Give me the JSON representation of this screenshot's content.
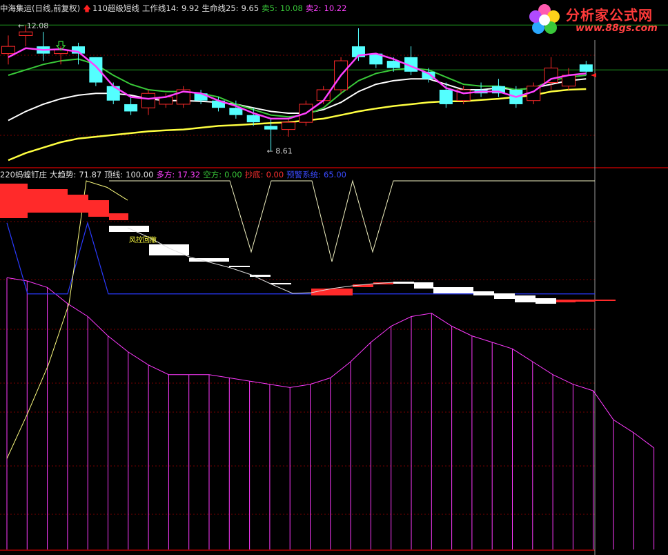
{
  "header_top": {
    "stock": "中海集运(日线,前复权)",
    "indicator": "110超级短线",
    "work_line_label": "工作线14:",
    "work_line_value": "9.92",
    "life_line_label": "生命线25:",
    "life_line_value": "9.65",
    "sell5_label": "卖5:",
    "sell5_value": "10.08",
    "sell2_label": "卖2:",
    "sell2_value": "10.22"
  },
  "header_bottom": {
    "indicator": "220蚂蝗钉庄",
    "trend_label": "大趋势:",
    "trend_value": "71.87",
    "top_label": "顶线:",
    "top_value": "100.00",
    "long_label": "多方:",
    "long_value": "17.32",
    "short_label": "空方:",
    "short_value": "0.00",
    "bottom_label": "抄底:",
    "bottom_value": "0.00",
    "alert_label": "预警系统:",
    "alert_value": "65.00"
  },
  "logo": {
    "title": "分析家公式网",
    "url": "www.88gs.com"
  },
  "annotations": {
    "high_label": "12.08",
    "low_label": "8.61",
    "stage_label": "风控回撤"
  },
  "colors": {
    "up": "#ff2a2a",
    "down": "#54ffff",
    "work_line": "#ff40ff",
    "life_line": "#39c939",
    "white_line": "#ffffff",
    "yellow_line": "#ffff40",
    "trend_line": "#ffff80",
    "alert_line": "#2a3aff",
    "long_bars": "#ff3aff",
    "grid": "#7a0000",
    "separator": "#b30000",
    "ref_line": "#20a020",
    "arrow": "#ff2020"
  },
  "chart_data": [
    {
      "type": "candlestick",
      "title": "中海集运(日线,前复权)",
      "annotations": {
        "high": 12.08,
        "low": 8.61
      },
      "ylim": [
        8.2,
        12.4
      ],
      "candles": [
        {
          "o": 11.3,
          "h": 11.8,
          "l": 11.0,
          "c": 11.5
        },
        {
          "o": 11.8,
          "h": 12.08,
          "l": 11.5,
          "c": 11.9
        },
        {
          "o": 11.5,
          "h": 11.9,
          "l": 11.1,
          "c": 11.3
        },
        {
          "o": 11.3,
          "h": 11.5,
          "l": 11.0,
          "c": 11.4
        },
        {
          "o": 11.5,
          "h": 11.6,
          "l": 11.0,
          "c": 11.3
        },
        {
          "o": 11.2,
          "h": 11.2,
          "l": 10.4,
          "c": 10.5
        },
        {
          "o": 10.4,
          "h": 10.5,
          "l": 9.9,
          "c": 10.0
        },
        {
          "o": 9.9,
          "h": 10.1,
          "l": 9.6,
          "c": 9.7
        },
        {
          "o": 9.8,
          "h": 10.3,
          "l": 9.6,
          "c": 10.2
        },
        {
          "o": 9.9,
          "h": 10.2,
          "l": 9.8,
          "c": 10.1
        },
        {
          "o": 9.9,
          "h": 10.4,
          "l": 9.8,
          "c": 10.3
        },
        {
          "o": 10.2,
          "h": 10.3,
          "l": 9.9,
          "c": 10.0
        },
        {
          "o": 10.0,
          "h": 10.1,
          "l": 9.7,
          "c": 9.8
        },
        {
          "o": 9.8,
          "h": 10.0,
          "l": 9.5,
          "c": 9.6
        },
        {
          "o": 9.6,
          "h": 9.8,
          "l": 9.3,
          "c": 9.4
        },
        {
          "o": 9.3,
          "h": 9.5,
          "l": 8.61,
          "c": 9.2
        },
        {
          "o": 9.2,
          "h": 9.5,
          "l": 9.0,
          "c": 9.4
        },
        {
          "o": 9.4,
          "h": 10.0,
          "l": 9.3,
          "c": 9.9
        },
        {
          "o": 10.0,
          "h": 10.4,
          "l": 9.9,
          "c": 10.3
        },
        {
          "o": 10.3,
          "h": 11.2,
          "l": 10.2,
          "c": 11.1
        },
        {
          "o": 11.5,
          "h": 12.0,
          "l": 11.1,
          "c": 11.2
        },
        {
          "o": 11.3,
          "h": 11.3,
          "l": 10.9,
          "c": 11.0
        },
        {
          "o": 11.1,
          "h": 11.2,
          "l": 10.8,
          "c": 10.9
        },
        {
          "o": 11.2,
          "h": 11.5,
          "l": 10.7,
          "c": 10.8
        },
        {
          "o": 10.8,
          "h": 10.9,
          "l": 10.5,
          "c": 10.6
        },
        {
          "o": 10.3,
          "h": 10.5,
          "l": 9.8,
          "c": 9.9
        },
        {
          "o": 10.0,
          "h": 10.4,
          "l": 9.9,
          "c": 10.3
        },
        {
          "o": 10.3,
          "h": 10.5,
          "l": 10.1,
          "c": 10.2
        },
        {
          "o": 10.4,
          "h": 10.6,
          "l": 10.1,
          "c": 10.2
        },
        {
          "o": 10.3,
          "h": 10.4,
          "l": 9.8,
          "c": 9.9
        },
        {
          "o": 10.0,
          "h": 10.5,
          "l": 9.9,
          "c": 10.4
        },
        {
          "o": 10.5,
          "h": 11.2,
          "l": 10.3,
          "c": 10.9
        },
        {
          "o": 10.4,
          "h": 10.9,
          "l": 10.3,
          "c": 10.7
        },
        {
          "o": 11.0,
          "h": 11.1,
          "l": 10.7,
          "c": 10.8
        }
      ],
      "series": [
        {
          "name": "工作线14",
          "values": [
            11.2,
            11.45,
            11.4,
            11.42,
            11.35,
            10.95,
            10.4,
            10.1,
            10.05,
            10.1,
            10.25,
            10.2,
            10.0,
            9.85,
            9.65,
            9.5,
            9.5,
            9.65,
            10.0,
            10.7,
            11.25,
            11.3,
            11.15,
            10.95,
            10.75,
            10.35,
            10.2,
            10.25,
            10.25,
            10.1,
            10.25,
            10.6,
            10.7,
            10.75
          ]
        },
        {
          "name": "生命线25",
          "values": [
            10.7,
            10.85,
            11.0,
            11.1,
            11.15,
            11.0,
            10.7,
            10.45,
            10.3,
            10.25,
            10.25,
            10.2,
            10.1,
            9.9,
            9.75,
            9.6,
            9.55,
            9.6,
            9.8,
            10.2,
            10.55,
            10.75,
            10.85,
            10.9,
            10.85,
            10.65,
            10.45,
            10.4,
            10.4,
            10.3,
            10.35,
            10.55,
            10.65,
            10.7
          ]
        },
        {
          "values": [
            9.45,
            9.7,
            9.9,
            10.05,
            10.15,
            10.2,
            10.2,
            10.15,
            10.05,
            10.0,
            10.0,
            9.98,
            9.95,
            9.9,
            9.8,
            9.7,
            9.65,
            9.65,
            9.75,
            9.95,
            10.25,
            10.45,
            10.55,
            10.6,
            10.6,
            10.45,
            10.3,
            10.3,
            10.35,
            10.3,
            10.35,
            10.45,
            10.55,
            10.6
          ]
        },
        {
          "values": [
            8.35,
            8.55,
            8.7,
            8.85,
            8.95,
            9.0,
            9.05,
            9.1,
            9.15,
            9.18,
            9.2,
            9.25,
            9.3,
            9.32,
            9.35,
            9.38,
            9.4,
            9.45,
            9.5,
            9.6,
            9.7,
            9.78,
            9.85,
            9.9,
            9.95,
            9.98,
            9.98,
            10.02,
            10.05,
            10.1,
            10.15,
            10.25,
            10.3,
            10.32
          ]
        }
      ]
    },
    {
      "type": "indicator",
      "title": "220蚂蝗钉庄",
      "ylim": [
        -15,
        100
      ],
      "reference_line": 100,
      "series": [
        {
          "name": "顶线",
          "values": [
            100,
            100,
            100,
            100,
            100,
            100,
            100,
            100,
            100,
            100,
            100,
            100,
            100,
            100,
            100,
            100,
            100,
            100,
            100,
            100,
            100,
            100,
            100,
            100,
            100,
            100,
            100,
            100,
            100,
            100,
            100,
            100,
            100,
            100,
            100,
            100,
            100,
            100,
            100,
            100,
            100,
            100,
            100,
            100,
            100,
            100,
            100,
            100,
            100,
            100,
            100,
            100,
            100,
            100,
            100,
            100,
            100,
            100,
            100,
            100,
            100,
            100,
            100,
            100,
            100,
            100,
            100,
            100,
            100,
            100,
            100,
            100,
            100,
            100,
            100,
            100,
            100,
            100,
            100,
            100,
            100
          ]
        },
        {
          "name": "大趋势",
          "values": [
            14,
            28,
            43,
            62,
            90,
            101,
            96,
            89,
            84,
            80,
            76,
            72,
            71.87
          ]
        },
        {
          "name": "预警系统",
          "values": [
            87,
            65,
            65,
            65,
            87,
            65,
            65,
            65,
            65,
            65,
            65,
            65,
            65,
            65,
            65,
            65,
            65,
            65,
            65,
            65,
            65,
            65,
            65,
            65,
            65,
            65,
            65,
            65,
            65
          ]
        },
        {
          "name": "多方",
          "values": [
            70,
            69,
            67,
            62,
            58,
            52,
            47,
            43,
            40,
            40,
            40,
            39,
            38,
            37,
            36,
            37,
            39,
            44,
            50,
            55,
            58,
            59,
            55,
            52,
            50,
            48,
            44,
            40,
            37,
            35,
            26,
            22,
            17.32
          ]
        }
      ]
    }
  ]
}
